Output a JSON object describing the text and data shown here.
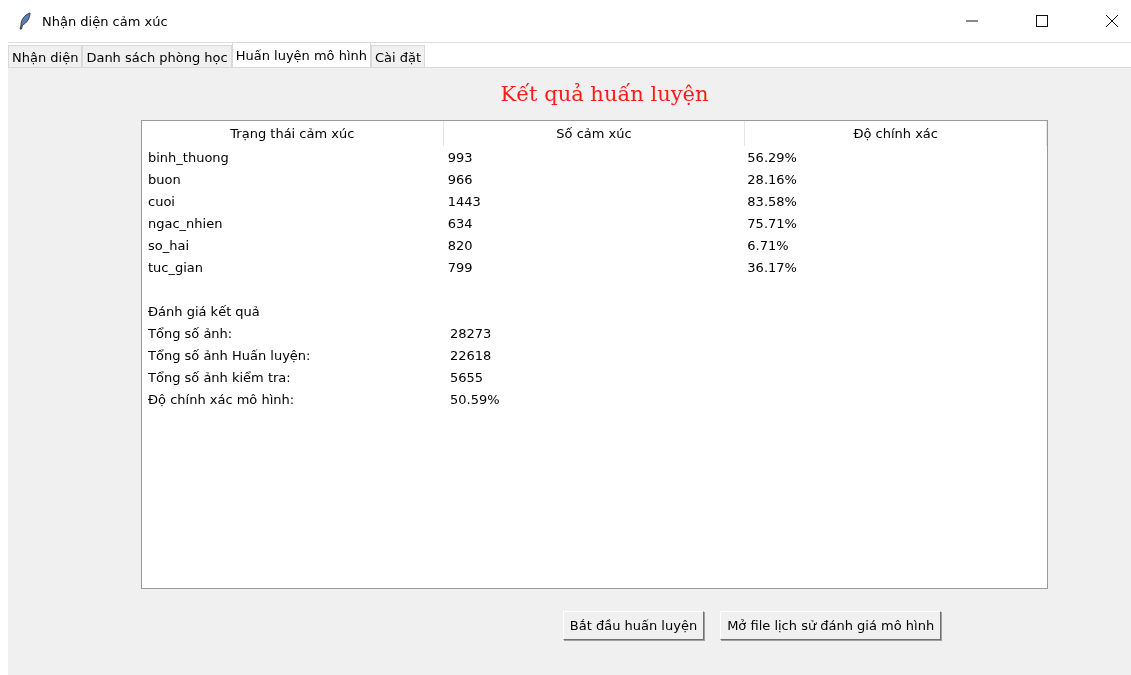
{
  "window": {
    "title": "Nhận diện cảm xúc"
  },
  "tabs": [
    {
      "label": "Nhận diện",
      "selected": false
    },
    {
      "label": "Danh sách phòng học",
      "selected": false
    },
    {
      "label": "Huấn luyện mô hình",
      "selected": true
    },
    {
      "label": "Cài đặt",
      "selected": false
    }
  ],
  "heading": "Kết quả huấn luyện",
  "table": {
    "columns": [
      "Trạng thái cảm xúc",
      "Số cảm xúc",
      "Độ chính xác"
    ],
    "rows": [
      [
        "binh_thuong",
        "993",
        "56.29%"
      ],
      [
        "buon",
        "966",
        "28.16%"
      ],
      [
        "cuoi",
        "1443",
        "83.58%"
      ],
      [
        "ngac_nhien",
        "634",
        "75.71%"
      ],
      [
        "so_hai",
        "820",
        "6.71%"
      ],
      [
        "tuc_gian",
        "799",
        "36.17%"
      ]
    ],
    "summary_title": "Đánh giá kết quả",
    "summary": [
      [
        "Tổng số ảnh:",
        "28273"
      ],
      [
        "Tổng số ảnh Huấn luyện:",
        "22618"
      ],
      [
        "Tổng số ảnh kiểm tra:",
        "5655"
      ],
      [
        "Độ chính xác mô hình:",
        "50.59%"
      ]
    ]
  },
  "buttons": [
    "Bắt đầu huấn luyện",
    "Mở file lịch sử đánh giá mô hình"
  ]
}
